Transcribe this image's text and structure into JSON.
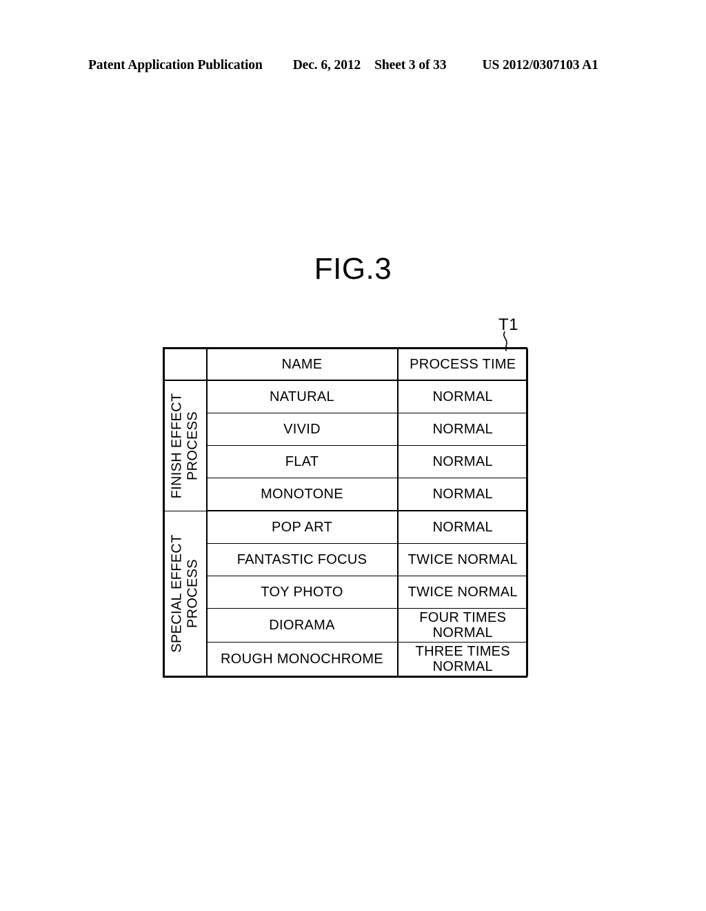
{
  "header": {
    "publication": "Patent Application Publication",
    "date": "Dec. 6, 2012",
    "sheet": "Sheet 3 of 33",
    "patent_number": "US 2012/0307103 A1"
  },
  "figure": {
    "title": "FIG.3",
    "reference_label": "T1"
  },
  "table": {
    "columns": {
      "group": "",
      "name": "NAME",
      "process_time": "PROCESS TIME"
    },
    "groups": [
      {
        "label_lines": [
          "FINISH EFFECT",
          "PROCESS"
        ],
        "rows": [
          {
            "name": "NATURAL",
            "time_lines": [
              "NORMAL"
            ]
          },
          {
            "name": "VIVID",
            "time_lines": [
              "NORMAL"
            ]
          },
          {
            "name": "FLAT",
            "time_lines": [
              "NORMAL"
            ]
          },
          {
            "name": "MONOTONE",
            "time_lines": [
              "NORMAL"
            ]
          }
        ]
      },
      {
        "label_lines": [
          "SPECIAL EFFECT",
          "PROCESS"
        ],
        "rows": [
          {
            "name": "POP ART",
            "time_lines": [
              "NORMAL"
            ]
          },
          {
            "name": "FANTASTIC FOCUS",
            "time_lines": [
              "TWICE NORMAL"
            ]
          },
          {
            "name": "TOY PHOTO",
            "time_lines": [
              "TWICE NORMAL"
            ]
          },
          {
            "name": "DIORAMA",
            "time_lines": [
              "FOUR TIMES",
              "NORMAL"
            ]
          },
          {
            "name": "ROUGH MONOCHROME",
            "time_lines": [
              "THREE TIMES",
              "NORMAL"
            ]
          }
        ]
      }
    ]
  }
}
